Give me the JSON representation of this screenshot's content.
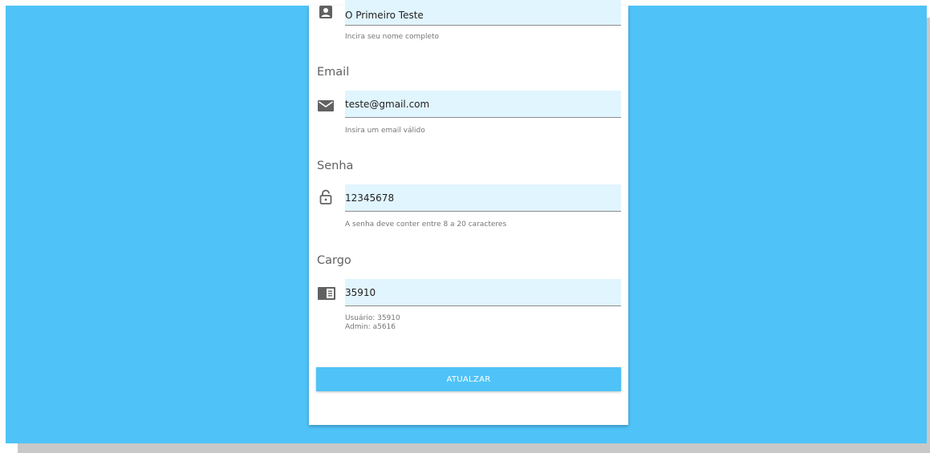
{
  "form": {
    "name": {
      "value": "O Primeiro Teste",
      "helper": "Incira seu nome completo",
      "icon": "person-icon"
    },
    "email": {
      "label": "Email",
      "value": "teste@gmail.com",
      "helper": "Insira um email válido",
      "icon": "mail-icon"
    },
    "password": {
      "label": "Senha",
      "value": "12345678",
      "helper": "A senha deve conter entre 8 a 20 caracteres",
      "icon": "lock-icon"
    },
    "role": {
      "label": "Cargo",
      "value": "35910",
      "helper_lines": [
        "Usuário: 35910",
        "Admin: a5616"
      ],
      "icon": "id-card-icon"
    },
    "submit_label": "ATUALZAR"
  },
  "colors": {
    "background": "#4fc3f7",
    "field": "#e1f5fe",
    "button": "#4fc3f7",
    "icon": "#616161"
  }
}
